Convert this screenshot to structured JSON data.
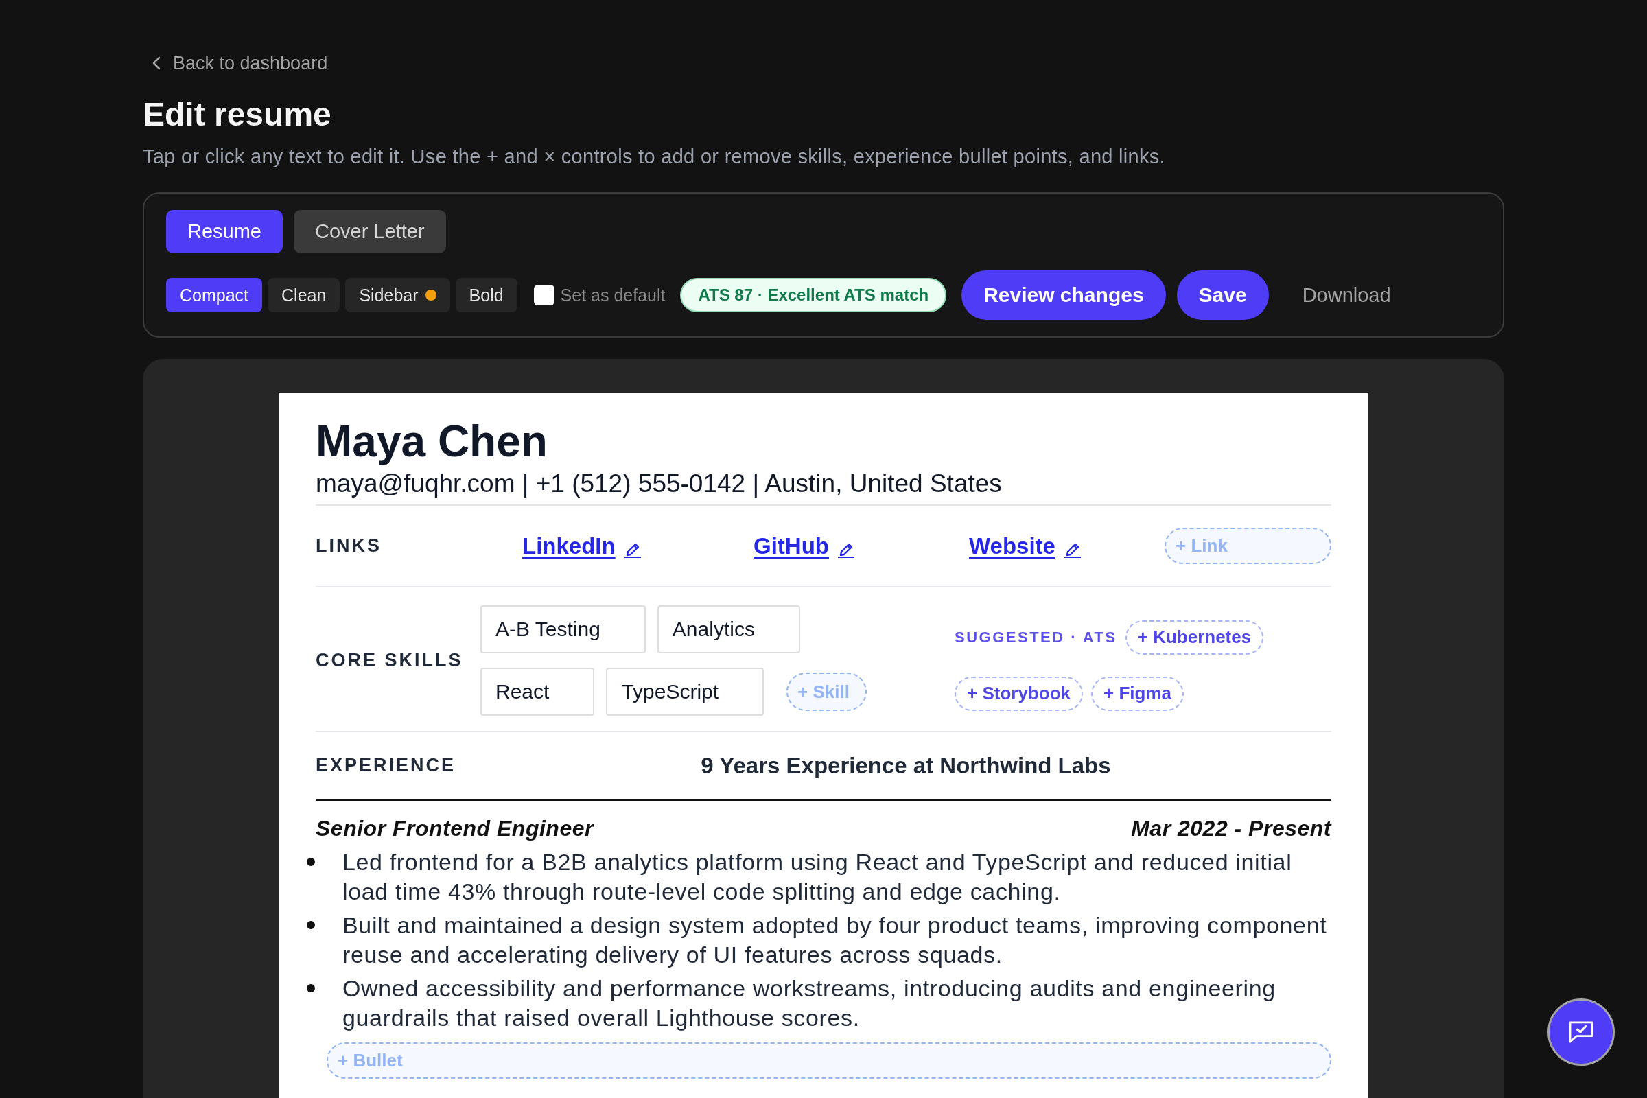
{
  "back_link": {
    "label": "Back to dashboard"
  },
  "header": {
    "title": "Edit resume",
    "description": "Tap or click any text to edit it. Use the + and × controls to add or remove skills, experience bullet points, and links."
  },
  "toolbar": {
    "tabs": [
      {
        "label": "Resume",
        "selected": true
      },
      {
        "label": "Cover Letter",
        "selected": false
      }
    ],
    "templates": [
      {
        "label": "Compact",
        "selected": true
      },
      {
        "label": "Clean",
        "selected": false
      },
      {
        "label": "Sidebar",
        "selected": false,
        "color": "#f59e0b"
      },
      {
        "label": "Bold",
        "selected": false
      }
    ],
    "set_default": {
      "label": "Set as default",
      "checked": false
    },
    "ats_badge": {
      "label": "ATS 87 · Excellent ATS match"
    },
    "actions": [
      {
        "label": "Review changes",
        "kind": "primary"
      },
      {
        "label": "Save",
        "kind": "primary"
      },
      {
        "label": "Download",
        "kind": "text"
      }
    ]
  },
  "resume": {
    "name": "Maya Chen",
    "contact": "maya@fuqhr.com | +1 (512) 555-0142 | Austin, United States",
    "links": {
      "heading": "LINKS",
      "items": [
        {
          "label": "LinkedIn"
        },
        {
          "label": "GitHub"
        },
        {
          "label": "Website"
        }
      ],
      "add_placeholder": "+ Link"
    },
    "skills": {
      "heading": "CORE SKILLS",
      "items": [
        "A-B Testing",
        "Analytics",
        "React",
        "TypeScript"
      ],
      "add_placeholder": "+ Skill",
      "suggested_label": "SUGGESTED · ATS",
      "suggestions": [
        "+ Kubernetes",
        "+ Storybook",
        "+ Figma"
      ]
    },
    "experience": {
      "heading": "EXPERIENCE",
      "summary": "9 Years Experience at Northwind Labs",
      "jobs": [
        {
          "title": "Senior Frontend Engineer",
          "dates": "Mar 2022 - Present",
          "bullets": [
            "Led frontend for a B2B analytics platform using React and TypeScript and reduced initial load time 43% through route-level code splitting and edge caching.",
            "Built and maintained a design system adopted by four product teams, improving component reuse and accelerating delivery of UI features across squads.",
            "Owned accessibility and performance workstreams, introducing audits and engineering guardrails that raised overall Lighthouse scores."
          ],
          "add_placeholder": "+ Bullet"
        }
      ]
    }
  }
}
